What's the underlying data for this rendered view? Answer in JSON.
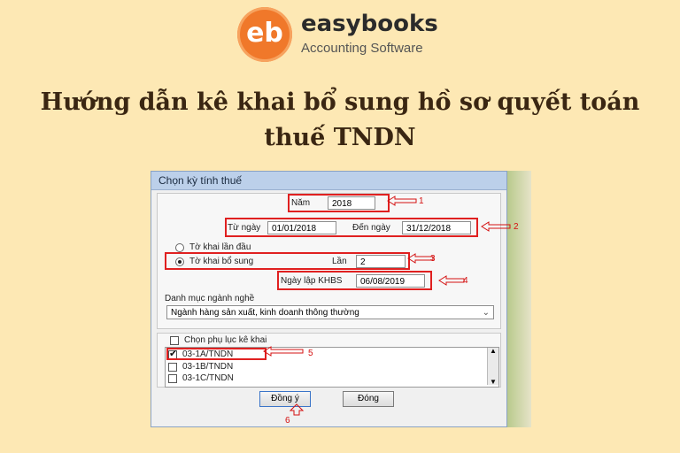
{
  "header": {
    "logo_mark": "eb",
    "brand": "easybooks",
    "tagline": "Accounting Software",
    "headline_line1": "Hướng dẫn kê khai bổ sung hồ sơ quyết toán",
    "headline_line2": "thuế TNDN"
  },
  "dialog": {
    "title": "Chọn kỳ tính thuế",
    "year_label": "Năm",
    "year_value": "2018",
    "from_label": "Từ ngày",
    "from_value": "01/01/2018",
    "to_label": "Đến ngày",
    "to_value": "31/12/2018",
    "radio_first": "Tờ khai lần đầu",
    "radio_supplement": "Tờ khai bổ sung",
    "times_label": "Lần",
    "times_value": "2",
    "date_label": "Ngày lập KHBS",
    "date_value": "06/08/2019",
    "industry_label": "Danh mục ngành nghề",
    "industry_value": "Ngành hàng sản xuất, kinh doanh thông thường",
    "appendix_label": "Chọn phụ lục kê khai",
    "appendix_items": [
      "03-1A/TNDN",
      "03-1B/TNDN",
      "03-1C/TNDN"
    ],
    "ok_label": "Đồng ý",
    "close_label": "Đóng"
  },
  "annotations": [
    "1",
    "2",
    "3",
    "4",
    "5",
    "6"
  ],
  "colors": {
    "background": "#fde8b4",
    "accent": "#f0782a",
    "highlight": "#e02020"
  }
}
